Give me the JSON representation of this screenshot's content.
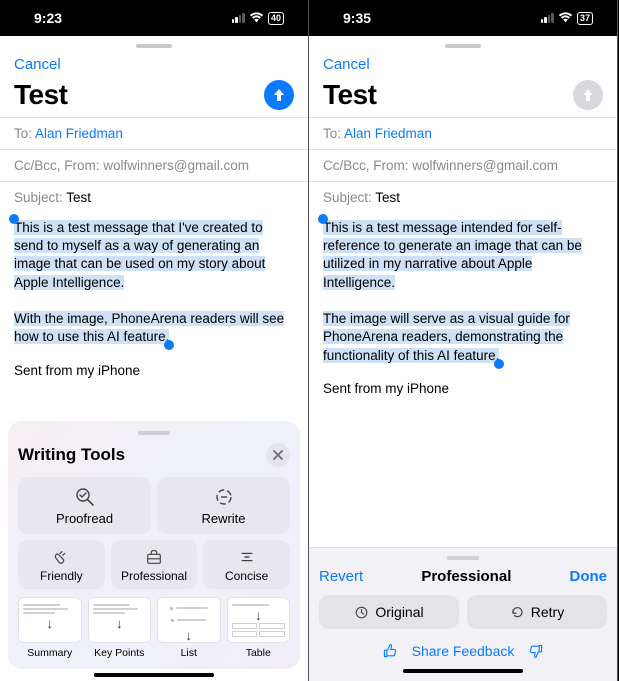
{
  "left": {
    "status": {
      "time": "9:23",
      "battery": "40"
    },
    "cancel": "Cancel",
    "title": "Test",
    "sendEnabled": true,
    "toLabel": "To:",
    "toName": "Alan Friedman",
    "ccFrom": "Cc/Bcc, From: wolfwinners@gmail.com",
    "subjectLabel": "Subject:",
    "subjectValue": "Test",
    "bodyP1": "This is a test message that I've created to send to myself as a way of generating an image that can be used on my story about Apple Intelligence.",
    "bodyP2": "With the image, PhoneArena readers will see how to use this AI feature.",
    "signature": "Sent from my iPhone",
    "wt": {
      "title": "Writing Tools",
      "proofread": "Proofread",
      "rewrite": "Rewrite",
      "friendly": "Friendly",
      "professional": "Professional",
      "concise": "Concise",
      "summary": "Summary",
      "keypoints": "Key Points",
      "list": "List",
      "table": "Table"
    }
  },
  "right": {
    "status": {
      "time": "9:35",
      "battery": "37"
    },
    "cancel": "Cancel",
    "title": "Test",
    "sendEnabled": false,
    "toLabel": "To:",
    "toName": "Alan Friedman",
    "ccFrom": "Cc/Bcc, From: wolfwinners@gmail.com",
    "subjectLabel": "Subject:",
    "subjectValue": "Test",
    "bodyP1": "This is a test message intended for self-reference to generate an image that can be utilized in my narrative about Apple Intelligence.",
    "bodyP2": "The image will serve as a visual guide for PhoneArena readers, demonstrating the functionality of this AI feature.",
    "signature": "Sent from my iPhone",
    "review": {
      "revert": "Revert",
      "title": "Professional",
      "done": "Done",
      "original": "Original",
      "retry": "Retry",
      "feedback": "Share Feedback"
    }
  }
}
